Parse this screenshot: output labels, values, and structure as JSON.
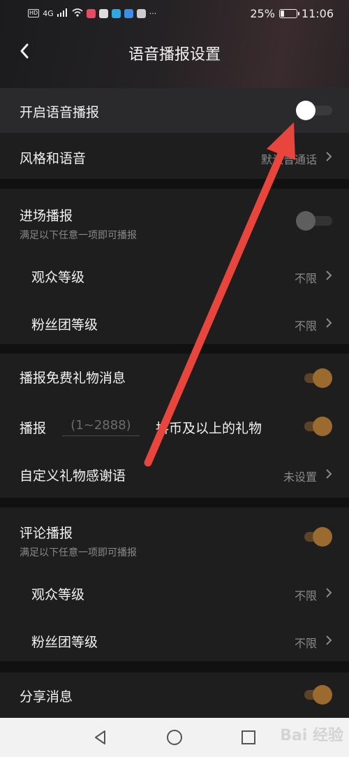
{
  "status_bar": {
    "hd": "HD",
    "network": "4G",
    "battery_percent": "25%",
    "time": "11:06",
    "dots": "···"
  },
  "header": {
    "title": "语音播报设置"
  },
  "rows": {
    "voice_broadcast": {
      "label": "开启语音播报",
      "toggle": "on-white"
    },
    "style_voice": {
      "label": "风格和语音",
      "value": "默认普通话"
    },
    "entry_broadcast": {
      "label": "进场播报",
      "sublabel": "满足以下任意一项即可播报",
      "toggle": "off"
    },
    "entry_audience_level": {
      "label": "观众等级",
      "value": "不限"
    },
    "entry_fan_level": {
      "label": "粉丝团等级",
      "value": "不限"
    },
    "free_gift": {
      "label": "播报免费礼物消息",
      "toggle": "on"
    },
    "gift_threshold": {
      "prefix": "播报",
      "placeholder": "(1~2888)",
      "suffix": "抖币及以上的礼物",
      "toggle": "on"
    },
    "custom_thanks": {
      "label": "自定义礼物感谢语",
      "value": "未设置"
    },
    "comment_broadcast": {
      "label": "评论播报",
      "sublabel": "满足以下任意一项即可播报",
      "toggle": "on"
    },
    "comment_audience_level": {
      "label": "观众等级",
      "value": "不限"
    },
    "comment_fan_level": {
      "label": "粉丝团等级",
      "value": "不限"
    },
    "share_message": {
      "label": "分享消息",
      "toggle": "on"
    }
  },
  "watermark": "Bai 经验",
  "colors": {
    "accent": "#9a6a2e",
    "arrow": "#e8453c",
    "background": "#111111",
    "row": "#1e1e1e"
  }
}
